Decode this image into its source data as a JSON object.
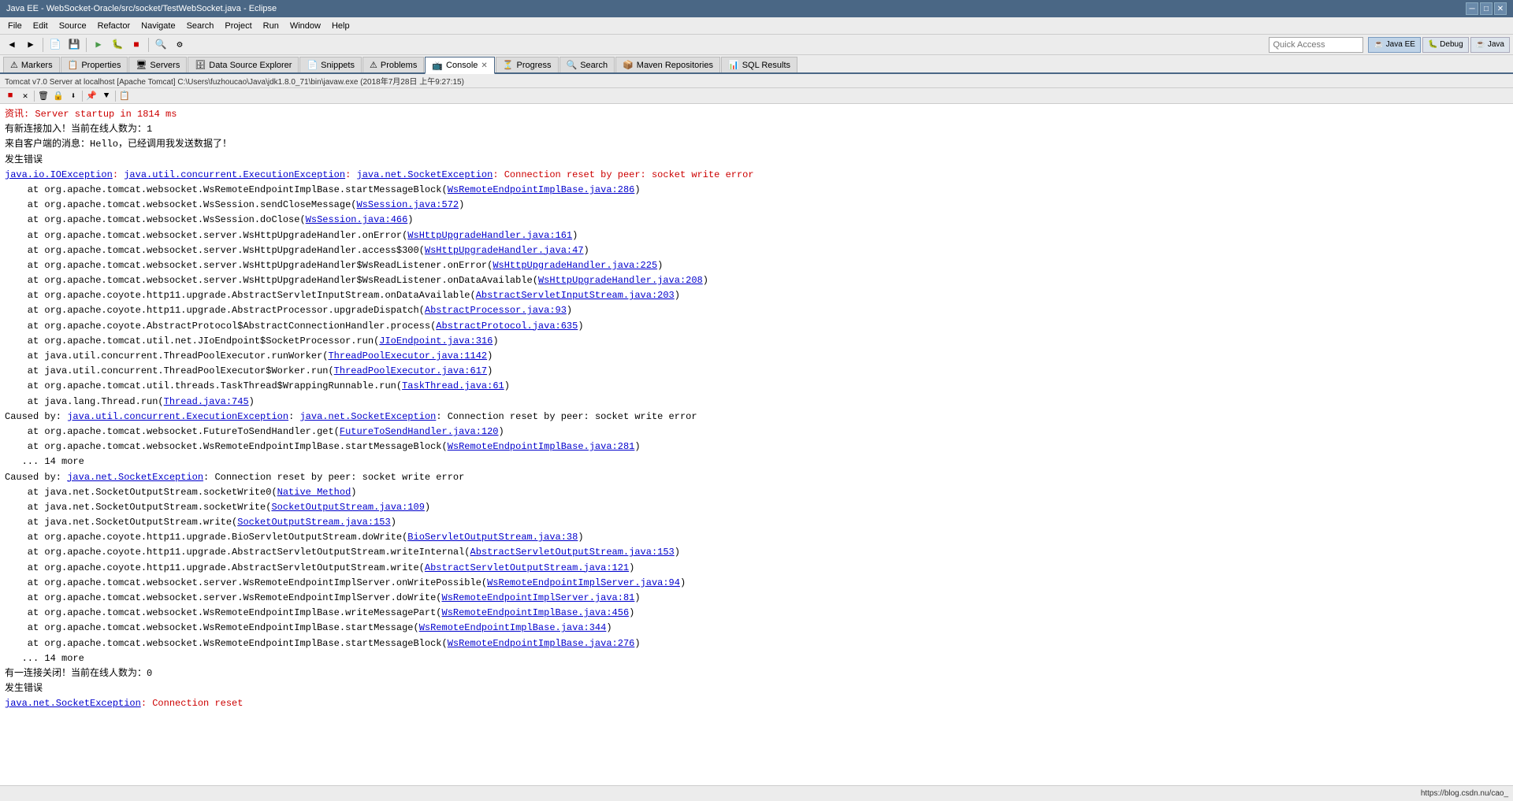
{
  "titleBar": {
    "title": "Java EE - WebSocket-Oracle/src/socket/TestWebSocket.java - Eclipse",
    "minimizeLabel": "─",
    "maximizeLabel": "□",
    "closeLabel": "✕"
  },
  "menuBar": {
    "items": [
      "File",
      "Edit",
      "Source",
      "Refactor",
      "Navigate",
      "Search",
      "Project",
      "Run",
      "Window",
      "Help"
    ]
  },
  "quickAccess": {
    "label": "Quick Access",
    "placeholder": "Quick Access"
  },
  "perspectives": {
    "items": [
      "Java EE",
      "Debug",
      "Java"
    ]
  },
  "tabs": {
    "items": [
      {
        "label": "Markers",
        "icon": "⚠"
      },
      {
        "label": "Properties",
        "icon": "📋"
      },
      {
        "label": "Servers",
        "icon": "🖥"
      },
      {
        "label": "Data Source Explorer",
        "icon": "🗄"
      },
      {
        "label": "Snippets",
        "icon": "📄"
      },
      {
        "label": "Problems",
        "icon": "⚠"
      },
      {
        "label": "Console",
        "icon": "📺",
        "active": true
      },
      {
        "label": "Progress",
        "icon": "⏳"
      },
      {
        "label": "Search",
        "icon": "🔍"
      },
      {
        "label": "Maven Repositories",
        "icon": "📦"
      },
      {
        "label": "SQL Results",
        "icon": "📊"
      }
    ]
  },
  "serverInfo": {
    "text": "Tomcat v7.0 Server at localhost [Apache Tomcat] C:\\Users\\fuzhoucao\\Java\\jdk1.8.0_71\\bin\\javaw.exe (2018年7月28日 上午9:27:15)"
  },
  "console": {
    "lines": [
      {
        "type": "red",
        "text": "资讯: Server startup in 1814 ms"
      },
      {
        "type": "black",
        "text": "有新连接加入！当前在线人数为：1"
      },
      {
        "type": "black",
        "text": "来自客户端的消息：Hello，已经调用我发送数据了！"
      },
      {
        "type": "black",
        "text": "发生错误"
      },
      {
        "type": "error_main",
        "text": "java.io.IOException: java.util.concurrent.ExecutionException: java.net.SocketException: Connection reset by peer: socket write error"
      },
      {
        "type": "stack",
        "text": "\tat org.apache.tomcat.websocket.WsRemoteEndpointImplBase.startMessageBlock(WsRemoteEndpointImplBase.java:286)",
        "link": "WsRemoteEndpointImplBase.java:286"
      },
      {
        "type": "stack",
        "text": "\tat org.apache.tomcat.websocket.WsSession.sendCloseMessage(WsSession.java:572)",
        "link": "WsSession.java:572"
      },
      {
        "type": "stack",
        "text": "\tat org.apache.tomcat.websocket.WsSession.doClose(WsSession.java:466)",
        "link": "WsSession.java:466"
      },
      {
        "type": "stack",
        "text": "\tat org.apache.tomcat.websocket.server.WsHttpUpgradeHandler.onError(WsHttpUpgradeHandler.java:161)",
        "link": "WsHttpUpgradeHandler.java:161"
      },
      {
        "type": "stack",
        "text": "\tat org.apache.tomcat.websocket.server.WsHttpUpgradeHandler.access$300(WsHttpUpgradeHandler.java:47)",
        "link": "WsHttpUpgradeHandler.java:47"
      },
      {
        "type": "stack",
        "text": "\tat org.apache.tomcat.websocket.server.WsHttpUpgradeHandler$WsReadListener.onError(WsHttpUpgradeHandler.java:225)",
        "link": "WsHttpUpgradeHandler.java:225"
      },
      {
        "type": "stack",
        "text": "\tat org.apache.tomcat.websocket.server.WsHttpUpgradeHandler$WsReadListener.onDataAvailable(WsHttpUpgradeHandler.java:208)",
        "link": "WsHttpUpgradeHandler.java:208"
      },
      {
        "type": "stack",
        "text": "\tat org.apache.coyote.http11.upgrade.AbstractServletInputStream.onDataAvailable(AbstractServletInputStream.java:203)",
        "link": "AbstractServletInputStream.java:203"
      },
      {
        "type": "stack",
        "text": "\tat org.apache.coyote.http11.upgrade.AbstractProcessor.upgradeDispatch(AbstractProcessor.java:93)",
        "link": "AbstractProcessor.java:93"
      },
      {
        "type": "stack",
        "text": "\tat org.apache.coyote.AbstractProtocol$AbstractConnectionHandler.process(AbstractProtocol.java:635)",
        "link": "AbstractProtocol.java:635"
      },
      {
        "type": "stack",
        "text": "\tat org.apache.tomcat.util.net.JIoEndpoint$SocketProcessor.run(JIoEndpoint.java:316)",
        "link": "JIoEndpoint.java:316"
      },
      {
        "type": "stack",
        "text": "\tat java.util.concurrent.ThreadPoolExecutor.runWorker(ThreadPoolExecutor.java:1142)",
        "link": "ThreadPoolExecutor.java:1142"
      },
      {
        "type": "stack",
        "text": "\tat java.util.concurrent.ThreadPoolExecutor$Worker.run(ThreadPoolExecutor.java:617)",
        "link": "ThreadPoolExecutor.java:617"
      },
      {
        "type": "stack",
        "text": "\tat org.apache.tomcat.util.threads.TaskThread$WrappingRunnable.run(TaskThread.java:61)",
        "link": "TaskThread.java:61"
      },
      {
        "type": "stack",
        "text": "\tat java.lang.Thread.run(Thread.java:745)",
        "link": "Thread.java:745"
      },
      {
        "type": "caused_by",
        "text": "Caused by: java.util.concurrent.ExecutionException: java.net.SocketException: Connection reset by peer: socket write error"
      },
      {
        "type": "stack",
        "text": "\tat org.apache.tomcat.websocket.FutureToSendHandler.get(FutureToSendHandler.java:120)",
        "link": "FutureToSendHandler.java:120"
      },
      {
        "type": "stack",
        "text": "\tat org.apache.tomcat.websocket.WsRemoteEndpointImplBase.startMessageBlock(WsRemoteEndpointImplBase.java:281)",
        "link": "WsRemoteEndpointImplBase.java:281"
      },
      {
        "type": "stack",
        "text": "\t... 14 more"
      },
      {
        "type": "caused_by2",
        "text": "Caused by: java.net.SocketException: Connection reset by peer: socket write error"
      },
      {
        "type": "stack",
        "text": "\tat java.net.SocketOutputStream.socketWrite0(Native Method)",
        "link": "Native Method"
      },
      {
        "type": "stack",
        "text": "\tat java.net.SocketOutputStream.socketWrite(SocketOutputStream.java:109)",
        "link": "SocketOutputStream.java:109"
      },
      {
        "type": "stack",
        "text": "\tat java.net.SocketOutputStream.write(SocketOutputStream.java:153)",
        "link": "SocketOutputStream.java:153"
      },
      {
        "type": "stack",
        "text": "\tat org.apache.coyote.http11.upgrade.BioServletOutputStream.doWrite(BioServletOutputStream.java:38)",
        "link": "BioServletOutputStream.java:38"
      },
      {
        "type": "stack",
        "text": "\tat org.apache.coyote.http11.upgrade.AbstractServletOutputStream.writeInternal(AbstractServletOutputStream.java:153)",
        "link": "AbstractServletOutputStream.java:153"
      },
      {
        "type": "stack",
        "text": "\tat org.apache.coyote.http11.upgrade.AbstractServletOutputStream.write(AbstractServletOutputStream.java:121)",
        "link": "AbstractServletOutputStream.java:121"
      },
      {
        "type": "stack",
        "text": "\tat org.apache.tomcat.websocket.server.WsRemoteEndpointImplServer.onWritePossible(WsRemoteEndpointImplServer.java:94)",
        "link": "WsRemoteEndpointImplServer.java:94"
      },
      {
        "type": "stack",
        "text": "\tat org.apache.tomcat.websocket.server.WsRemoteEndpointImplServer.doWrite(WsRemoteEndpointImplServer.java:81)",
        "link": "WsRemoteEndpointImplServer.java:81"
      },
      {
        "type": "stack",
        "text": "\tat org.apache.tomcat.websocket.WsRemoteEndpointImplBase.writeMessagePart(WsRemoteEndpointImplBase.java:456)",
        "link": "WsRemoteEndpointImplBase.java:456"
      },
      {
        "type": "stack",
        "text": "\tat org.apache.tomcat.websocket.WsRemoteEndpointImplBase.startMessage(WsRemoteEndpointImplBase.java:344)",
        "link": "WsRemoteEndpointImplBase.java:344"
      },
      {
        "type": "stack",
        "text": "\tat org.apache.tomcat.websocket.WsRemoteEndpointImplBase.startMessageBlock(WsRemoteEndpointImplBase.java:276)",
        "link": "WsRemoteEndpointImplBase.java:276"
      },
      {
        "type": "stack",
        "text": "\t... 14 more"
      },
      {
        "type": "black",
        "text": "有一连接关闭！当前在线人数为：0"
      },
      {
        "type": "black",
        "text": "发生错误"
      },
      {
        "type": "error_main2",
        "text": "java.net.SocketException: Connection reset"
      }
    ]
  },
  "statusBar": {
    "url": "https://blog.csdn.nu/cao_"
  },
  "consoleToolbar": {
    "buttons": [
      "■",
      "✕",
      "⏸",
      "📋",
      "🔽",
      "🔼",
      "⚙",
      "📌",
      "📌"
    ]
  }
}
